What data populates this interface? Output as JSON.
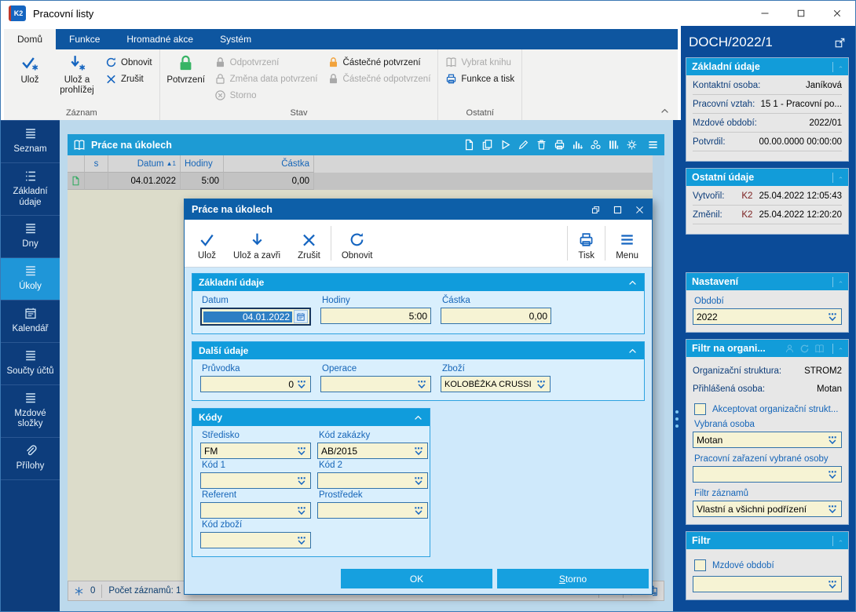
{
  "window": {
    "title": "Pracovní listy",
    "logo": "K2"
  },
  "ribbon": {
    "tabs": [
      {
        "label": "Domů"
      },
      {
        "label": "Funkce"
      },
      {
        "label": "Hromadné akce"
      },
      {
        "label": "Systém"
      }
    ],
    "zaznam": {
      "label": "Záznam",
      "uloz": "Ulož",
      "uloz_prohlizej": "Ulož a prohlížej",
      "obnovit": "Obnovit",
      "zrusit": "Zrušit"
    },
    "stav": {
      "label": "Stav",
      "potvrzeni": "Potvrzení",
      "odpotvrzeni": "Odpotvrzení",
      "zmena_data": "Změna data potvrzení",
      "storno": "Storno",
      "castecne_potvrzeni": "Částečné potvrzení",
      "castecne_odpotvrzeni": "Částečné odpotvrzení"
    },
    "ostatni": {
      "label": "Ostatní",
      "vybrat_knihu": "Vybrat knihu",
      "funkce_a_tisk": "Funkce a tisk"
    }
  },
  "sidebar": {
    "items": [
      {
        "label": "Seznam"
      },
      {
        "label": "Základní údaje"
      },
      {
        "label": "Dny"
      },
      {
        "label": "Úkoly"
      },
      {
        "label": "Kalendář"
      },
      {
        "label": "Součty účtů"
      },
      {
        "label": "Mzdové složky"
      },
      {
        "label": "Přílohy"
      }
    ]
  },
  "browse": {
    "title": "Práce na úkolech",
    "columns": {
      "s": "s",
      "datum": "Datum",
      "hodiny": "Hodiny",
      "castka": "Částka"
    },
    "sort": {
      "glyph": "▲",
      "order": "1"
    },
    "row": {
      "datum": "04.01.2022",
      "hodiny": "5:00",
      "castka": "0,00"
    },
    "status": {
      "tasks": "0",
      "records": "Počet záznamů: 1"
    }
  },
  "dialog": {
    "title": "Práce na úkolech",
    "toolbar": {
      "uloz": "Ulož",
      "uloz_a_zavri": "Ulož a zavři",
      "zrusit": "Zrušit",
      "obnovit": "Obnovit",
      "tisk": "Tisk",
      "menu": "Menu"
    },
    "zakladni": {
      "title": "Základní údaje",
      "datum": {
        "label": "Datum",
        "value": "04.01.2022"
      },
      "hodiny": {
        "label": "Hodiny",
        "value": "5:00"
      },
      "castka": {
        "label": "Částka",
        "value": "0,00"
      }
    },
    "dalsi": {
      "title": "Další údaje",
      "pruvodka": {
        "label": "Průvodka",
        "value": "0"
      },
      "operace": {
        "label": "Operace",
        "value": ""
      },
      "zbozi": {
        "label": "Zboží",
        "value": "KOLOBĚŽKA CRUSSI"
      }
    },
    "kody": {
      "title": "Kódy",
      "stredisko": {
        "label": "Středisko",
        "value": "FM"
      },
      "kod_zakazky": {
        "label": "Kód zakázky",
        "value": "AB/2015"
      },
      "kod1": {
        "label": "Kód 1",
        "value": ""
      },
      "kod2": {
        "label": "Kód 2",
        "value": ""
      },
      "referent": {
        "label": "Referent",
        "value": ""
      },
      "prostredek": {
        "label": "Prostředek",
        "value": ""
      },
      "kod_zbozi": {
        "label": "Kód zboží",
        "value": ""
      }
    },
    "buttons": {
      "ok": "OK",
      "storno": "Storno"
    }
  },
  "right_panel": {
    "header": "DOCH/2022/1",
    "zakladni": {
      "title": "Základní údaje",
      "rows": [
        {
          "label": "Kontaktní osoba:",
          "value": "Janíková"
        },
        {
          "label": "Pracovní vztah:",
          "value": "15 1 - Pracovní po..."
        },
        {
          "label": "Mzdové období:",
          "value": "2022/01"
        },
        {
          "label": "Potvrdil:",
          "value": "00.00.0000 00:00:00"
        }
      ]
    },
    "ostatni": {
      "title": "Ostatní údaje",
      "rows": [
        {
          "label": "Vytvořil:",
          "user": "K2",
          "value": "25.04.2022 12:05:43"
        },
        {
          "label": "Změnil:",
          "user": "K2",
          "value": "25.04.2022 12:20:20"
        }
      ]
    },
    "nastaveni": {
      "title": "Nastavení",
      "obdobi": {
        "label": "Období",
        "value": "2022"
      }
    },
    "filtr_org": {
      "title": "Filtr na organi...",
      "rows": [
        {
          "label": "Organizační struktura:",
          "value": "STROM2"
        },
        {
          "label": "Přihlášená osoba:",
          "value": "Motan"
        }
      ],
      "checkbox": "Akceptovat organizační strukt...",
      "vybrana": {
        "label": "Vybraná osoba",
        "value": "Motan"
      },
      "zarazeni": {
        "label": "Pracovní zařazení vybrané osoby",
        "value": ""
      },
      "zaznamy": {
        "label": "Filtr záznamů",
        "value": "Vlastní a všichni podřízení"
      }
    },
    "filtr": {
      "title": "Filtr",
      "checkbox": "Mzdové období",
      "value": ""
    }
  }
}
